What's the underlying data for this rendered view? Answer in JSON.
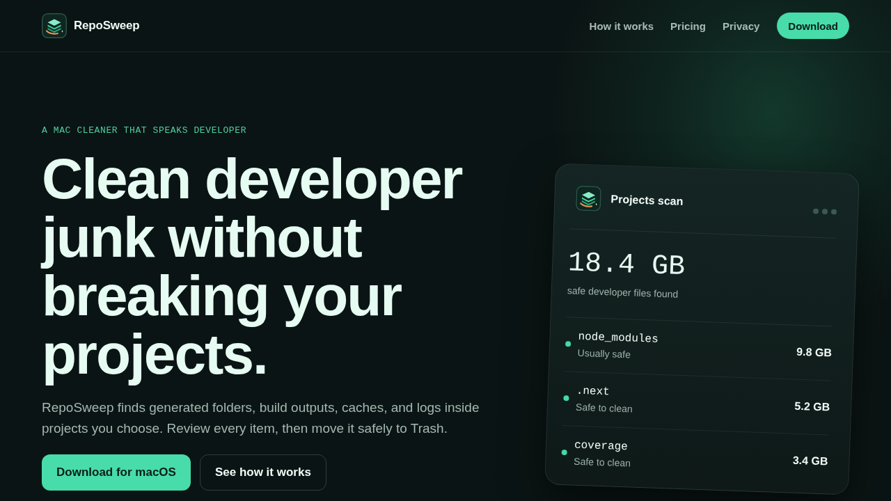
{
  "header": {
    "brand": "RepoSweep",
    "nav": [
      {
        "label": "How it works"
      },
      {
        "label": "Pricing"
      },
      {
        "label": "Privacy"
      }
    ],
    "cta": "Download"
  },
  "hero": {
    "eyebrow": "A MAC CLEANER THAT SPEAKS DEVELOPER",
    "title": "Clean developer junk without breaking your projects.",
    "description": "RepoSweep finds generated folders, build outputs, caches, and logs inside projects you choose. Review every item, then move it safely to Trash.",
    "buttons": [
      {
        "label": "Download for macOS",
        "kind": "primary"
      },
      {
        "label": "See how it works",
        "kind": "secondary"
      }
    ]
  },
  "scan_card": {
    "title": "Projects scan",
    "total": "18.4 GB",
    "total_caption": "safe developer files found",
    "items": [
      {
        "name": "node_modules",
        "status": "Usually safe",
        "size": "9.8 GB"
      },
      {
        "name": ".next",
        "status": "Safe to clean",
        "size": "5.2 GB"
      },
      {
        "name": "coverage",
        "status": "Safe to clean",
        "size": "3.4 GB"
      }
    ]
  }
}
